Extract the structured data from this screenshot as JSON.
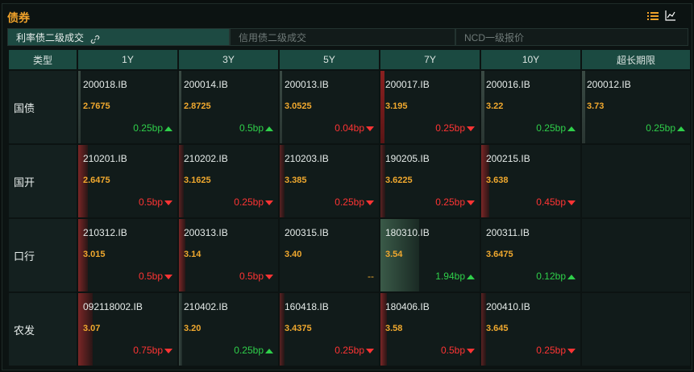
{
  "title": "债券",
  "tabs": [
    {
      "label": "利率债二级成交",
      "active": true
    },
    {
      "label": "信用债二级成交",
      "active": false
    },
    {
      "label": "NCD一级报价",
      "active": false
    }
  ],
  "columns": [
    "类型",
    "1Y",
    "3Y",
    "5Y",
    "7Y",
    "10Y",
    "超长期限"
  ],
  "rows": [
    {
      "type": "国债",
      "cells": [
        {
          "code": "200018.IB",
          "price": "2.7675",
          "change": "0.25bp",
          "dir": "up"
        },
        {
          "code": "200014.IB",
          "price": "2.8725",
          "change": "0.5bp",
          "dir": "up"
        },
        {
          "code": "200013.IB",
          "price": "3.0525",
          "change": "0.04bp",
          "dir": "down"
        },
        {
          "code": "200017.IB",
          "price": "3.195",
          "change": "0.25bp",
          "dir": "down"
        },
        {
          "code": "200016.IB",
          "price": "3.22",
          "change": "0.25bp",
          "dir": "up"
        },
        {
          "code": "200012.IB",
          "price": "3.73",
          "change": "0.25bp",
          "dir": "up"
        }
      ]
    },
    {
      "type": "国开",
      "cells": [
        {
          "code": "210201.IB",
          "price": "2.6475",
          "change": "0.5bp",
          "dir": "down"
        },
        {
          "code": "210202.IB",
          "price": "3.1625",
          "change": "0.25bp",
          "dir": "down"
        },
        {
          "code": "210203.IB",
          "price": "3.385",
          "change": "0.25bp",
          "dir": "down"
        },
        {
          "code": "190205.IB",
          "price": "3.6225",
          "change": "0.25bp",
          "dir": "down"
        },
        {
          "code": "200215.IB",
          "price": "3.638",
          "change": "0.45bp",
          "dir": "down"
        },
        null
      ]
    },
    {
      "type": "口行",
      "cells": [
        {
          "code": "210312.IB",
          "price": "3.015",
          "change": "0.5bp",
          "dir": "down"
        },
        {
          "code": "200313.IB",
          "price": "3.14",
          "change": "0.5bp",
          "dir": "down"
        },
        {
          "code": "200315.IB",
          "price": "3.40",
          "change": "--",
          "dir": "flat"
        },
        {
          "code": "180310.IB",
          "price": "3.54",
          "change": "1.94bp",
          "dir": "up"
        },
        {
          "code": "200311.IB",
          "price": "3.6475",
          "change": "0.12bp",
          "dir": "up"
        },
        null
      ]
    },
    {
      "type": "农发",
      "cells": [
        {
          "code": "092118002.IB",
          "price": "3.07",
          "change": "0.75bp",
          "dir": "down"
        },
        {
          "code": "210402.IB",
          "price": "3.20",
          "change": "0.25bp",
          "dir": "up"
        },
        {
          "code": "160418.IB",
          "price": "3.4375",
          "change": "0.25bp",
          "dir": "down"
        },
        {
          "code": "180406.IB",
          "price": "3.58",
          "change": "0.5bp",
          "dir": "down"
        },
        {
          "code": "200410.IB",
          "price": "3.645",
          "change": "0.25bp",
          "dir": "down"
        },
        null
      ]
    }
  ],
  "colors": {
    "accent": "#f0a22a",
    "up": "#2fcf4a",
    "down": "#ff3434",
    "header": "#1b4a41"
  }
}
